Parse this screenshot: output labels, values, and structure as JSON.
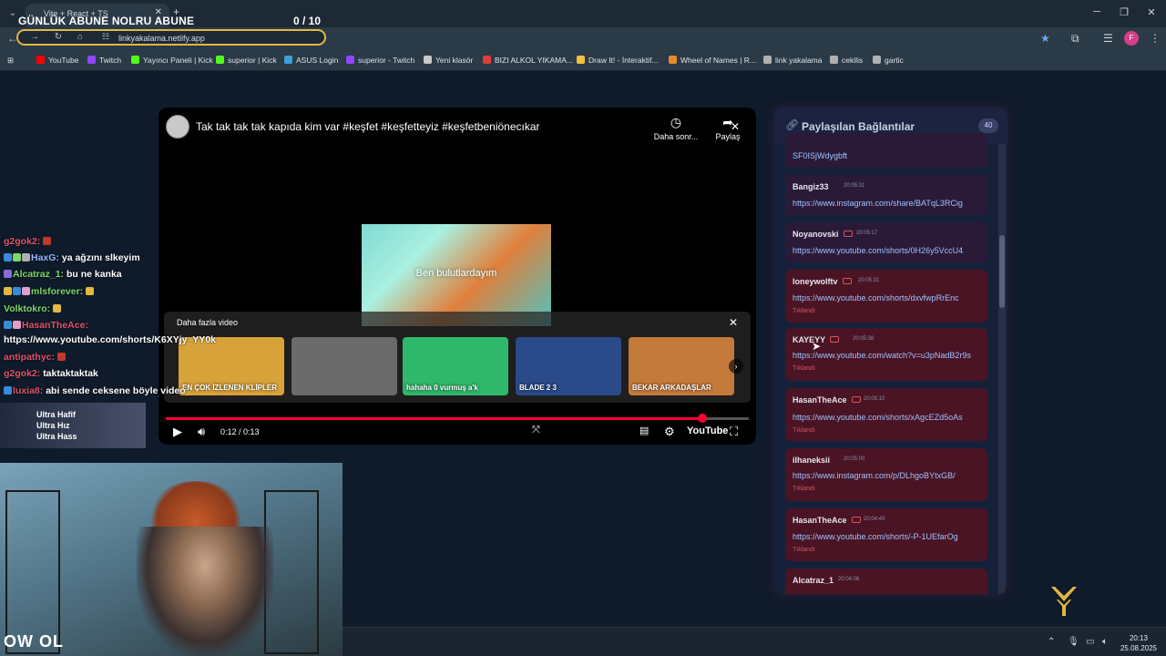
{
  "browser": {
    "tab_title": "Vite + React + TS",
    "overlay_title": "GÜNLÜK ABUNE NOLRU ABUNE",
    "overlay_count": "0  / 10",
    "url": "linkyakalama.netlify.app",
    "profile_initial": "F",
    "bookmarks": [
      {
        "label": "YouTube",
        "color": "#ff0000"
      },
      {
        "label": "Twitch",
        "color": "#9146ff"
      },
      {
        "label": "Yayıncı Paneli | Kick",
        "color": "#53fc18"
      },
      {
        "label": "superior | Kick",
        "color": "#53fc18"
      },
      {
        "label": "ASUS Login",
        "color": "#3aa0d8"
      },
      {
        "label": "superior - Twitch",
        "color": "#9146ff"
      },
      {
        "label": "Yeni klasör",
        "color": "#c9c9c9"
      },
      {
        "label": "BIZI ALKOL YIKAMA...",
        "color": "#e23b3b"
      },
      {
        "label": "Draw It! - İnteraktif...",
        "color": "#f0c040"
      },
      {
        "label": "Wheel of Names | R...",
        "color": "#e88a2a"
      },
      {
        "label": "link yakalama",
        "color": "#b0b0b0"
      },
      {
        "label": "cekilis",
        "color": "#b0b0b0"
      },
      {
        "label": "gartic",
        "color": "#b0b0b0"
      }
    ]
  },
  "video": {
    "title": "Tak tak tak tak kapıda kim var #keşfet #keşfetteyiz #keşfetbeniönecıkar",
    "watch_later": "Daha sonr...",
    "share": "Paylaş",
    "frame_text": "Ben bulutlardayım",
    "more_title": "Daha fazla video",
    "thumbs": [
      {
        "text": "EN ÇOK İZLENEN KLİPLER",
        "bg": "#d8a23a"
      },
      {
        "text": "",
        "bg": "#6a6a6a"
      },
      {
        "text": "hahaha 0 vurmuş a'k",
        "bg": "#2fb86a"
      },
      {
        "text": "BLADE 2 3",
        "bg": "#2a4a8a"
      },
      {
        "text": "BEKAR ARKADAŞLAR",
        "bg": "#c47a3a"
      }
    ],
    "time": "0:12 / 0:13",
    "progress": 0.92,
    "yt_label": "YouTube"
  },
  "panel": {
    "title": "Paylaşılan Bağlantılar",
    "count": "40",
    "links": [
      {
        "user": "",
        "time": "",
        "url": "SF0ISjWdygbft",
        "clicked": "",
        "kind": "plain"
      },
      {
        "user": "Bangiz33",
        "time": "20:05:31",
        "url": "https://www.instagram.com/share/BATqL3RCig",
        "clicked": "",
        "kind": "plain"
      },
      {
        "user": "Noyanovski",
        "time": "20:05:17",
        "url": "https://www.youtube.com/shorts/0H26y5VccU4",
        "clicked": "",
        "kind": "plain"
      },
      {
        "user": "loneywolftv",
        "time": "20:05:31",
        "url": "https://www.youtube.com/shorts/dxvfwpRrEnc",
        "clicked": "Tıklandı",
        "kind": "clicked"
      },
      {
        "user": "KAYEYY",
        "time": "20:05:38",
        "url": "https://www.youtube.com/watch?v=u3pNadB2r9s",
        "clicked": "Tıklandı",
        "kind": "clicked"
      },
      {
        "user": "HasanTheAce",
        "time": "20:05:10",
        "url": "https://www.youtube.com/shorts/xAgcEZd5oAs",
        "clicked": "Tıklandı",
        "kind": "clicked"
      },
      {
        "user": "ilhaneksii",
        "time": "20:05:00",
        "url": "https://www.instagram.com/p/DLhgoBYtxGB/",
        "clicked": "Tıklandı",
        "kind": "clicked"
      },
      {
        "user": "HasanTheAce",
        "time": "20:04:49",
        "url": "https://www.youtube.com/shorts/-P-1UEfarOg",
        "clicked": "Tıklandı",
        "kind": "clicked"
      },
      {
        "user": "Alcatraz_1",
        "time": "20:04:06",
        "url": "",
        "clicked": "",
        "kind": "clicked"
      }
    ]
  },
  "chat": [
    {
      "user": "g2gok2:",
      "msg": "",
      "color": "#e0546a"
    },
    {
      "user": "HaxG:",
      "msg": "ya ağzını slkeyim",
      "color": "#8fb8ff"
    },
    {
      "user": "Alcatraz_1:",
      "msg": "bu ne kanka",
      "color": "#7dd86a"
    },
    {
      "user": "mlsforever:",
      "msg": "",
      "color": "#7dd86a"
    },
    {
      "user": "Volktokro:",
      "msg": "",
      "color": "#7dd86a"
    },
    {
      "user": "HasanTheAce:",
      "msg": "",
      "color": "#e0546a"
    },
    {
      "user": "",
      "msg": "https://www.youtube.com/shorts/K6XYjy_YY0k",
      "color": "#ffffff"
    },
    {
      "user": "antipathyc:",
      "msg": "",
      "color": "#e0546a"
    },
    {
      "user": "g2gok2:",
      "msg": "taktaktaktak",
      "color": "#e0546a"
    },
    {
      "user": "luxia8:",
      "msg": "abi sende ceksene böyle video",
      "color": "#e0546a"
    }
  ],
  "ad": {
    "lines": [
      "Ultra Hafif",
      "Ultra Hız",
      "Ultra Hass"
    ]
  },
  "webcam": {
    "brand": "OW OL"
  },
  "taskbar": {
    "time": "20:13",
    "date": "25.08.2025"
  }
}
